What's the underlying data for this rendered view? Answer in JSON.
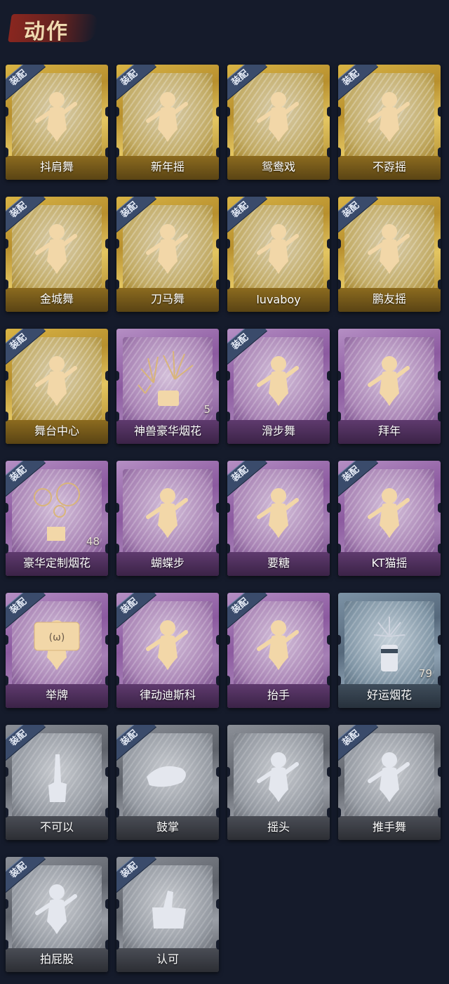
{
  "section": {
    "title": "动作"
  },
  "equipped_label": "装配",
  "theme_colors": {
    "background": "#151b2b",
    "gold": "#c9a53a",
    "purple": "#9a6cae",
    "blue": "#6d8194",
    "gray": "#7d8189",
    "badge": "#3a4b6b"
  },
  "actions": [
    {
      "name": "抖肩舞",
      "rarity": "gold",
      "equipped": true,
      "icon": "dance-figure-icon"
    },
    {
      "name": "新年摇",
      "rarity": "gold",
      "equipped": true,
      "icon": "dance-figure-icon"
    },
    {
      "name": "鸳鸯戏",
      "rarity": "gold",
      "equipped": true,
      "icon": "dance-figure-icon"
    },
    {
      "name": "不孬摇",
      "rarity": "gold",
      "equipped": true,
      "icon": "dance-figure-icon"
    },
    {
      "name": "金城舞",
      "rarity": "gold",
      "equipped": true,
      "icon": "dance-figure-icon"
    },
    {
      "name": "刀马舞",
      "rarity": "gold",
      "equipped": true,
      "icon": "dance-figure-icon"
    },
    {
      "name": "luvaboy",
      "rarity": "gold",
      "equipped": true,
      "icon": "dance-figure-icon"
    },
    {
      "name": "鹏友摇",
      "rarity": "gold",
      "equipped": true,
      "icon": "dance-figure-icon"
    },
    {
      "name": "舞台中心",
      "rarity": "gold",
      "equipped": true,
      "icon": "dance-figure-icon"
    },
    {
      "name": "神兽豪华烟花",
      "rarity": "purple",
      "equipped": false,
      "icon": "fireworks-pot-icon",
      "count": "5"
    },
    {
      "name": "滑步舞",
      "rarity": "purple",
      "equipped": true,
      "icon": "dance-figure-icon"
    },
    {
      "name": "拜年",
      "rarity": "purple",
      "equipped": false,
      "icon": "bow-figure-icon"
    },
    {
      "name": "豪华定制烟花",
      "rarity": "purple",
      "equipped": true,
      "icon": "fireworks-box-icon",
      "count": "48"
    },
    {
      "name": "蝴蝶步",
      "rarity": "purple",
      "equipped": false,
      "icon": "dance-figure-icon"
    },
    {
      "name": "要糖",
      "rarity": "purple",
      "equipped": true,
      "icon": "reach-figure-icon"
    },
    {
      "name": "KT猫摇",
      "rarity": "purple",
      "equipped": true,
      "icon": "dance-figure-icon"
    },
    {
      "name": "举牌",
      "rarity": "purple",
      "equipped": true,
      "icon": "sign-figure-icon"
    },
    {
      "name": "律动迪斯科",
      "rarity": "purple",
      "equipped": true,
      "icon": "disco-figure-icon"
    },
    {
      "name": "抬手",
      "rarity": "purple",
      "equipped": true,
      "icon": "reach-figure-icon"
    },
    {
      "name": "好运烟花",
      "rarity": "blue",
      "equipped": false,
      "icon": "firecracker-icon",
      "count": "79"
    },
    {
      "name": "不可以",
      "rarity": "gray",
      "equipped": true,
      "icon": "finger-wag-icon"
    },
    {
      "name": "鼓掌",
      "rarity": "gray",
      "equipped": true,
      "icon": "clap-icon"
    },
    {
      "name": "摇头",
      "rarity": "gray",
      "equipped": false,
      "icon": "shake-head-figure-icon"
    },
    {
      "name": "推手舞",
      "rarity": "gray",
      "equipped": true,
      "icon": "dance-figure-icon"
    },
    {
      "name": "拍屁股",
      "rarity": "gray",
      "equipped": true,
      "icon": "bend-figure-icon"
    },
    {
      "name": "认可",
      "rarity": "gray",
      "equipped": true,
      "icon": "thumbs-up-icon"
    }
  ]
}
